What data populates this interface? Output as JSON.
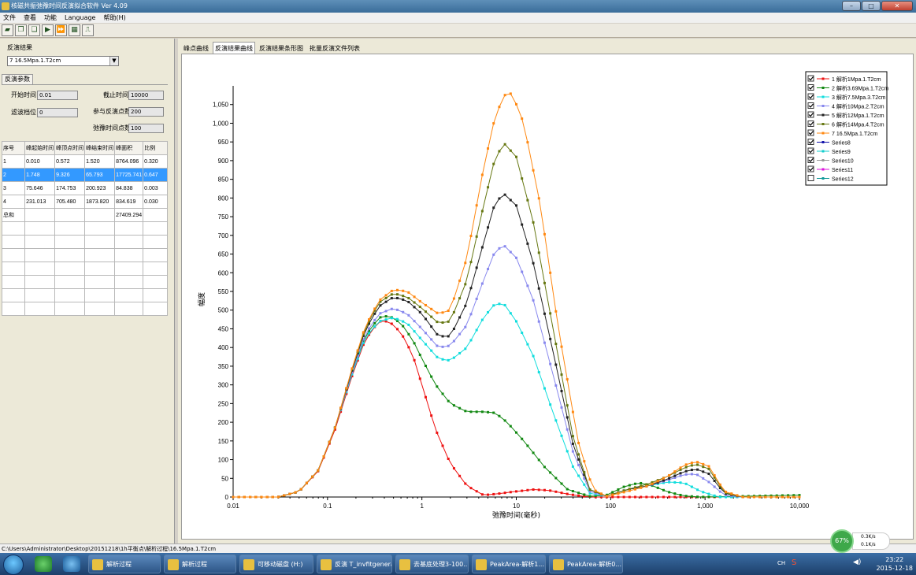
{
  "window": {
    "title": "核磁共振弛豫时间反演拟合软件 Ver 4.09",
    "min": "–",
    "max": "□",
    "close": "✕"
  },
  "menu": [
    "文件",
    "查看",
    "功能",
    "Language",
    "帮助(H)"
  ],
  "toolbar": [
    "open-icon",
    "copy-icon",
    "export-icon",
    "play-icon",
    "fast-forward-icon",
    "table-icon",
    "chart-icon"
  ],
  "left": {
    "group_label": "反演结果",
    "selected_result": "7 16.5Mpa.1.T2cm",
    "params_tab": "反演参数",
    "start_time_label": "开始时间",
    "start_time": "0.01",
    "end_time_label": "截止时间",
    "end_time": "10000",
    "filter_label": "滤波档位",
    "filter": "0",
    "points_label": "参与反演点数",
    "points": "200",
    "relax_points_label": "弛豫时间点数",
    "relax_points": "100",
    "table_headers": [
      "序号",
      "峰起始时间",
      "峰顶点时间",
      "峰结束时间",
      "峰面积",
      "比例"
    ],
    "table_rows": [
      [
        "1",
        "0.010",
        "0.572",
        "1.520",
        "8764.096",
        "0.320"
      ],
      [
        "2",
        "1.748",
        "9.326",
        "65.793",
        "17725.741",
        "0.647"
      ],
      [
        "3",
        "75.646",
        "174.753",
        "200.923",
        "84.838",
        "0.003"
      ],
      [
        "4",
        "231.013",
        "705.480",
        "1873.820",
        "834.619",
        "0.030"
      ],
      [
        "总和",
        "",
        "",
        "",
        "27409.294",
        ""
      ]
    ],
    "empty_rows": 7
  },
  "tabs": [
    "峰点曲线",
    "反演结果曲线",
    "反演结果条形图",
    "批量反演文件列表"
  ],
  "active_tab": 1,
  "statusbar": "C:\\Users\\Administrator\\Desktop\\20151218\\1h平衡点\\解析过程\\16.5Mpa.1.T2cm",
  "taskbar": {
    "tasks": [
      "解析过程",
      "解析过程",
      "可移动磁盘 (H:)",
      "反演  T_invfitgeneral",
      "去基底处理3-100...",
      "PeakArea-解析1...",
      "PeakArea-解析0..."
    ],
    "clock_time": "23:22",
    "clock_date": "2015-12-18",
    "lang": "CH"
  },
  "netwidget": {
    "percent": "67%",
    "up": "0.3K/s",
    "down": "0.1K/s"
  },
  "chart_data": {
    "type": "line",
    "xscale": "log",
    "xlim": [
      0.01,
      10000
    ],
    "ylim": [
      0,
      1100
    ],
    "xticks": [
      "0.01",
      "0.1",
      "1",
      "10",
      "100",
      "1,000",
      "10,000"
    ],
    "yticks": [
      "0",
      "50",
      "100",
      "150",
      "200",
      "250",
      "300",
      "350",
      "400",
      "450",
      "500",
      "550",
      "600",
      "650",
      "700",
      "750",
      "800",
      "850",
      "900",
      "950",
      "1,000",
      "1,050"
    ],
    "xlabel": "弛豫时间(毫秒)",
    "ylabel": "幅度",
    "legend_position": "top-right",
    "series": [
      {
        "name": "1 解析1Mpa.1.T2cm",
        "color": "#ee1111",
        "checked": true,
        "pts": [
          [
            0.01,
            0
          ],
          [
            0.03,
            0
          ],
          [
            0.05,
            15
          ],
          [
            0.08,
            70
          ],
          [
            0.12,
            180
          ],
          [
            0.18,
            320
          ],
          [
            0.25,
            420
          ],
          [
            0.35,
            470
          ],
          [
            0.45,
            470
          ],
          [
            0.6,
            440
          ],
          [
            0.8,
            380
          ],
          [
            1.0,
            300
          ],
          [
            1.4,
            180
          ],
          [
            2,
            90
          ],
          [
            3,
            30
          ],
          [
            4.5,
            5
          ],
          [
            6,
            8
          ],
          [
            10,
            15
          ],
          [
            15,
            20
          ],
          [
            22,
            18
          ],
          [
            35,
            8
          ],
          [
            50,
            2
          ],
          [
            70,
            0
          ],
          [
            10000,
            0
          ]
        ]
      },
      {
        "name": "2 解析3.69Mpa.1.T2cm",
        "color": "#118811",
        "checked": true,
        "pts": [
          [
            0.01,
            0
          ],
          [
            0.03,
            0
          ],
          [
            0.05,
            15
          ],
          [
            0.08,
            72
          ],
          [
            0.12,
            185
          ],
          [
            0.18,
            330
          ],
          [
            0.25,
            430
          ],
          [
            0.35,
            480
          ],
          [
            0.45,
            485
          ],
          [
            0.6,
            465
          ],
          [
            0.8,
            420
          ],
          [
            1.0,
            370
          ],
          [
            1.4,
            300
          ],
          [
            2,
            250
          ],
          [
            3,
            228
          ],
          [
            4.5,
            228
          ],
          [
            6,
            225
          ],
          [
            8,
            200
          ],
          [
            12,
            150
          ],
          [
            20,
            80
          ],
          [
            35,
            20
          ],
          [
            60,
            2
          ],
          [
            90,
            5
          ],
          [
            140,
            28
          ],
          [
            200,
            38
          ],
          [
            280,
            30
          ],
          [
            400,
            14
          ],
          [
            600,
            3
          ],
          [
            900,
            0
          ],
          [
            10000,
            5
          ]
        ]
      },
      {
        "name": "3 解析7.5Mpa.3.T2cm",
        "color": "#11dddd",
        "checked": true,
        "pts": [
          [
            0.01,
            0
          ],
          [
            0.03,
            0
          ],
          [
            0.05,
            15
          ],
          [
            0.08,
            72
          ],
          [
            0.12,
            185
          ],
          [
            0.18,
            325
          ],
          [
            0.25,
            425
          ],
          [
            0.35,
            470
          ],
          [
            0.5,
            480
          ],
          [
            0.7,
            465
          ],
          [
            1.0,
            420
          ],
          [
            1.5,
            370
          ],
          [
            2,
            365
          ],
          [
            3,
            400
          ],
          [
            4.5,
            480
          ],
          [
            6,
            518
          ],
          [
            7.5,
            515
          ],
          [
            10,
            470
          ],
          [
            15,
            380
          ],
          [
            25,
            220
          ],
          [
            40,
            80
          ],
          [
            60,
            10
          ],
          [
            90,
            2
          ],
          [
            150,
            20
          ],
          [
            250,
            30
          ],
          [
            400,
            40
          ],
          [
            600,
            38
          ],
          [
            900,
            15
          ],
          [
            1400,
            0
          ],
          [
            10000,
            0
          ]
        ]
      },
      {
        "name": "4 解析10Mpa.2.T2cm",
        "color": "#8888ee",
        "checked": true,
        "pts": [
          [
            0.01,
            0
          ],
          [
            0.03,
            0
          ],
          [
            0.05,
            15
          ],
          [
            0.08,
            72
          ],
          [
            0.12,
            185
          ],
          [
            0.18,
            330
          ],
          [
            0.25,
            435
          ],
          [
            0.35,
            490
          ],
          [
            0.5,
            505
          ],
          [
            0.7,
            490
          ],
          [
            1.0,
            450
          ],
          [
            1.5,
            400
          ],
          [
            2,
            405
          ],
          [
            3,
            460
          ],
          [
            4.5,
            580
          ],
          [
            6,
            660
          ],
          [
            7.5,
            672
          ],
          [
            10,
            640
          ],
          [
            15,
            530
          ],
          [
            25,
            320
          ],
          [
            40,
            120
          ],
          [
            60,
            15
          ],
          [
            90,
            2
          ],
          [
            150,
            20
          ],
          [
            250,
            30
          ],
          [
            400,
            45
          ],
          [
            600,
            60
          ],
          [
            800,
            62
          ],
          [
            1100,
            40
          ],
          [
            1600,
            5
          ],
          [
            2500,
            0
          ],
          [
            10000,
            0
          ]
        ]
      },
      {
        "name": "5 解析12Mpa.1.T2cm",
        "color": "#222222",
        "checked": true,
        "pts": [
          [
            0.01,
            0
          ],
          [
            0.03,
            0
          ],
          [
            0.05,
            15
          ],
          [
            0.08,
            72
          ],
          [
            0.12,
            185
          ],
          [
            0.18,
            335
          ],
          [
            0.25,
            445
          ],
          [
            0.35,
            510
          ],
          [
            0.5,
            535
          ],
          [
            0.7,
            525
          ],
          [
            1.0,
            490
          ],
          [
            1.5,
            430
          ],
          [
            2,
            430
          ],
          [
            3,
            520
          ],
          [
            4.5,
            680
          ],
          [
            6,
            790
          ],
          [
            7.5,
            810
          ],
          [
            10,
            780
          ],
          [
            15,
            630
          ],
          [
            25,
            380
          ],
          [
            40,
            140
          ],
          [
            60,
            20
          ],
          [
            90,
            2
          ],
          [
            150,
            20
          ],
          [
            250,
            30
          ],
          [
            400,
            48
          ],
          [
            600,
            68
          ],
          [
            800,
            75
          ],
          [
            1100,
            62
          ],
          [
            1600,
            10
          ],
          [
            2500,
            0
          ],
          [
            10000,
            0
          ]
        ]
      },
      {
        "name": "6 解析14Mpa.4.T2cm",
        "color": "#667711",
        "checked": true,
        "pts": [
          [
            0.01,
            0
          ],
          [
            0.03,
            0
          ],
          [
            0.05,
            15
          ],
          [
            0.08,
            72
          ],
          [
            0.12,
            185
          ],
          [
            0.18,
            338
          ],
          [
            0.25,
            450
          ],
          [
            0.35,
            520
          ],
          [
            0.5,
            545
          ],
          [
            0.7,
            535
          ],
          [
            1.0,
            505
          ],
          [
            1.5,
            465
          ],
          [
            2,
            470
          ],
          [
            3,
            580
          ],
          [
            4.5,
            780
          ],
          [
            6,
            910
          ],
          [
            7.5,
            945
          ],
          [
            10,
            910
          ],
          [
            15,
            740
          ],
          [
            25,
            440
          ],
          [
            40,
            160
          ],
          [
            60,
            20
          ],
          [
            90,
            2
          ],
          [
            150,
            20
          ],
          [
            250,
            35
          ],
          [
            400,
            55
          ],
          [
            600,
            78
          ],
          [
            800,
            88
          ],
          [
            1100,
            75
          ],
          [
            1600,
            12
          ],
          [
            2500,
            0
          ],
          [
            10000,
            0
          ]
        ]
      },
      {
        "name": "7 16.5Mpa.1.T2cm",
        "color": "#ff8811",
        "checked": true,
        "pts": [
          [
            0.01,
            0
          ],
          [
            0.03,
            0
          ],
          [
            0.05,
            15
          ],
          [
            0.08,
            72
          ],
          [
            0.12,
            185
          ],
          [
            0.18,
            340
          ],
          [
            0.25,
            455
          ],
          [
            0.35,
            525
          ],
          [
            0.5,
            555
          ],
          [
            0.7,
            550
          ],
          [
            1.0,
            520
          ],
          [
            1.5,
            490
          ],
          [
            2,
            500
          ],
          [
            3,
            640
          ],
          [
            4.5,
            880
          ],
          [
            6,
            1020
          ],
          [
            7.5,
            1075
          ],
          [
            9,
            1080
          ],
          [
            12,
            1000
          ],
          [
            18,
            780
          ],
          [
            28,
            450
          ],
          [
            45,
            150
          ],
          [
            65,
            20
          ],
          [
            90,
            2
          ],
          [
            150,
            15
          ],
          [
            250,
            30
          ],
          [
            400,
            55
          ],
          [
            600,
            85
          ],
          [
            800,
            95
          ],
          [
            1100,
            82
          ],
          [
            1600,
            15
          ],
          [
            2500,
            0
          ],
          [
            10000,
            0
          ]
        ]
      }
    ],
    "extra_legend": [
      {
        "name": "Series8",
        "color": "#1111aa",
        "checked": true
      },
      {
        "name": "Series9",
        "color": "#11cccc",
        "checked": true
      },
      {
        "name": "Series10",
        "color": "#999999",
        "checked": true
      },
      {
        "name": "Series11",
        "color": "#dd11dd",
        "checked": true
      },
      {
        "name": "Series12",
        "color": "#119999",
        "checked": false
      }
    ]
  }
}
